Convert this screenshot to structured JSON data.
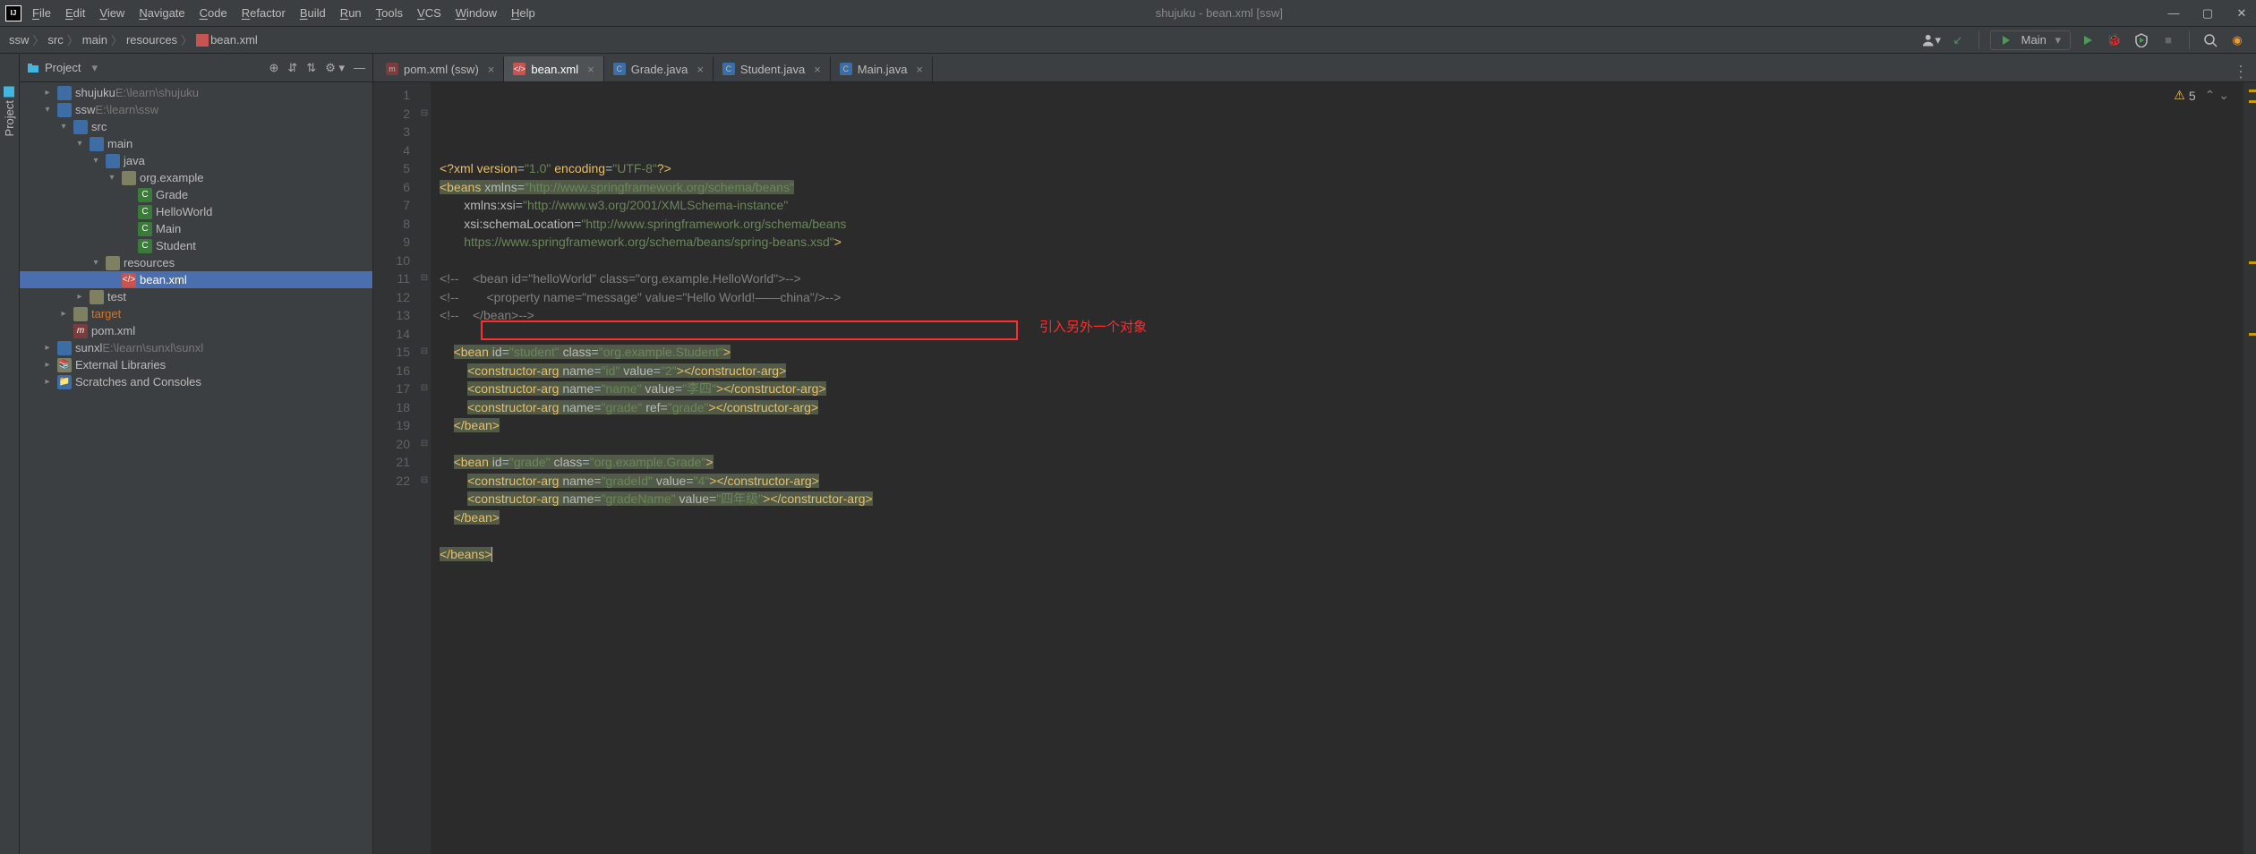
{
  "window": {
    "title": "shujuku - bean.xml [ssw]"
  },
  "menu": [
    "File",
    "Edit",
    "View",
    "Navigate",
    "Code",
    "Refactor",
    "Build",
    "Run",
    "Tools",
    "VCS",
    "Window",
    "Help"
  ],
  "breadcrumb": [
    "ssw",
    "src",
    "main",
    "resources",
    "bean.xml"
  ],
  "run_config": "Main",
  "sidebar_title": "Project",
  "sidebar_tab_label": "Project",
  "tree": [
    {
      "d": 0,
      "arrow": "closed",
      "icon": "folder-blue",
      "label": "shujuku",
      "suffix": "E:\\learn\\shujuku"
    },
    {
      "d": 0,
      "arrow": "open",
      "icon": "folder-blue",
      "label": "ssw",
      "suffix": "E:\\learn\\ssw"
    },
    {
      "d": 1,
      "arrow": "open",
      "icon": "folder-blue",
      "label": "src"
    },
    {
      "d": 2,
      "arrow": "open",
      "icon": "folder-blue",
      "label": "main"
    },
    {
      "d": 3,
      "arrow": "open",
      "icon": "folder-blue",
      "label": "java"
    },
    {
      "d": 4,
      "arrow": "open",
      "icon": "package",
      "label": "org.example"
    },
    {
      "d": 5,
      "arrow": "",
      "icon": "class",
      "label": "Grade"
    },
    {
      "d": 5,
      "arrow": "",
      "icon": "class",
      "label": "HelloWorld"
    },
    {
      "d": 5,
      "arrow": "",
      "icon": "class",
      "label": "Main"
    },
    {
      "d": 5,
      "arrow": "",
      "icon": "class",
      "label": "Student"
    },
    {
      "d": 3,
      "arrow": "open",
      "icon": "folder",
      "label": "resources"
    },
    {
      "d": 4,
      "arrow": "",
      "icon": "xml",
      "label": "bean.xml",
      "selected": true
    },
    {
      "d": 2,
      "arrow": "closed",
      "icon": "folder",
      "label": "test"
    },
    {
      "d": 1,
      "arrow": "closed",
      "icon": "folder",
      "label": "target",
      "orange": true
    },
    {
      "d": 1,
      "arrow": "",
      "icon": "maven",
      "label": "pom.xml"
    },
    {
      "d": 0,
      "arrow": "closed",
      "icon": "folder-blue",
      "label": "sunxl",
      "suffix": "E:\\learn\\sunxl\\sunxl"
    },
    {
      "d": 0,
      "arrow": "closed",
      "icon": "lib",
      "label": "External Libraries"
    },
    {
      "d": 0,
      "arrow": "closed",
      "icon": "scratch",
      "label": "Scratches and Consoles"
    }
  ],
  "tabs": [
    {
      "icon": "maven",
      "label": "pom.xml (ssw)"
    },
    {
      "icon": "xml",
      "label": "bean.xml",
      "active": true
    },
    {
      "icon": "java",
      "label": "Grade.java"
    },
    {
      "icon": "java",
      "label": "Student.java"
    },
    {
      "icon": "java",
      "label": "Main.java"
    }
  ],
  "problems_count": "5",
  "annotation": "引入另外一个对象",
  "code_lines": [
    {
      "n": 1,
      "html": "<span class='tg'>&lt;?</span><span class='tg'>xml version</span><span class='eq'>=</span><span class='st'>\"1.0\"</span> <span class='tg'>encoding</span><span class='eq'>=</span><span class='st'>\"UTF-8\"</span><span class='tg'>?&gt;</span>"
    },
    {
      "n": 2,
      "html": "<span class='hl'><span class='tg'>&lt;beans</span> <span class='at'>xmlns</span><span class='eq'>=</span><span class='st'>\"http://www.springframework.org/schema/beans\"</span></span>",
      "fold": "⊟"
    },
    {
      "n": 3,
      "html": "       <span class='at'>xmlns:xsi</span><span class='eq'>=</span><span class='st'>\"http://www.w3.org/2001/XMLSchema-instance\"</span>"
    },
    {
      "n": 4,
      "html": "       <span class='at'>xsi:schemaLocation</span><span class='eq'>=</span><span class='st'>\"http://www.springframework.org/schema/beans</span>"
    },
    {
      "n": 5,
      "html": "       <span class='st'>https://www.springframework.org/schema/beans/spring-beans.xsd\"</span><span class='tg'>&gt;</span>"
    },
    {
      "n": 6,
      "html": ""
    },
    {
      "n": 7,
      "html": "<span class='cm'>&lt;!--    &lt;bean id=\"helloWorld\" class=\"org.example.HelloWorld\"&gt;--&gt;</span>"
    },
    {
      "n": 8,
      "html": "<span class='cm'>&lt;!--        &lt;property name=\"message\" value=\"Hello World!——china\"/&gt;--&gt;</span>"
    },
    {
      "n": 9,
      "html": "<span class='cm'>&lt;!--    &lt;/bean&gt;--&gt;</span>"
    },
    {
      "n": 10,
      "html": ""
    },
    {
      "n": 11,
      "html": "    <span class='hl'><span class='tg'>&lt;bean</span> <span class='at'>id</span><span class='eq'>=</span><span class='st'>\"student\"</span> <span class='at'>class</span><span class='eq'>=</span><span class='st'>\"org.example.Student\"</span><span class='tg'>&gt;</span></span>",
      "fold": "⊟"
    },
    {
      "n": 12,
      "html": "        <span class='hl'><span class='tg'>&lt;constructor-arg</span> <span class='at'>name</span><span class='eq'>=</span><span class='st'>\"id\"</span> <span class='at'>value</span><span class='eq'>=</span><span class='st'>\"2\"</span><span class='tg'>&gt;&lt;/constructor-arg&gt;</span></span>"
    },
    {
      "n": 13,
      "html": "        <span class='hl'><span class='tg'>&lt;constructor-arg</span> <span class='at'>name</span><span class='eq'>=</span><span class='st'>\"name\"</span> <span class='at'>value</span><span class='eq'>=</span><span class='st'>\"李四\"</span><span class='tg'>&gt;&lt;/constructor-arg&gt;</span></span>"
    },
    {
      "n": 14,
      "html": "        <span class='hl'><span class='tg'>&lt;constructor-arg</span> <span class='at'>name</span><span class='eq'>=</span><span class='st'>\"grade\"</span> <span class='at'>ref</span><span class='eq'>=</span><span class='st'>\"grade\"</span><span class='tg'>&gt;&lt;/constructor-arg&gt;</span></span>"
    },
    {
      "n": 15,
      "html": "    <span class='hl'><span class='tg'>&lt;/bean&gt;</span></span>",
      "fold": "⊟"
    },
    {
      "n": 16,
      "html": ""
    },
    {
      "n": 17,
      "html": "    <span class='hl'><span class='tg'>&lt;bean</span> <span class='at'>id</span><span class='eq'>=</span><span class='st'>\"grade\"</span> <span class='at'>class</span><span class='eq'>=</span><span class='st'>\"org.example.Grade\"</span><span class='tg'>&gt;</span></span>",
      "fold": "⊟"
    },
    {
      "n": 18,
      "html": "        <span class='hl'><span class='tg'>&lt;constructor-arg</span> <span class='at'>name</span><span class='eq'>=</span><span class='st'>\"gradeId\"</span> <span class='at'>value</span><span class='eq'>=</span><span class='st'>\"4\"</span><span class='tg'>&gt;&lt;/constructor-arg&gt;</span></span>"
    },
    {
      "n": 19,
      "html": "        <span class='hl'><span class='tg'>&lt;constructor-arg</span> <span class='at'>name</span><span class='eq'>=</span><span class='st'>\"gradeName\"</span> <span class='at'>value</span><span class='eq'>=</span><span class='st'>\"四年级\"</span><span class='tg'>&gt;&lt;/constructor-arg&gt;</span></span>"
    },
    {
      "n": 20,
      "html": "    <span class='hl'><span class='tg'>&lt;/bean&gt;</span></span>",
      "fold": "⊟"
    },
    {
      "n": 21,
      "html": ""
    },
    {
      "n": 22,
      "html": "<span class='hl'><span class='tg'>&lt;/beans&gt;</span></span><span class='caret'></span>",
      "fold": "⊟"
    }
  ]
}
